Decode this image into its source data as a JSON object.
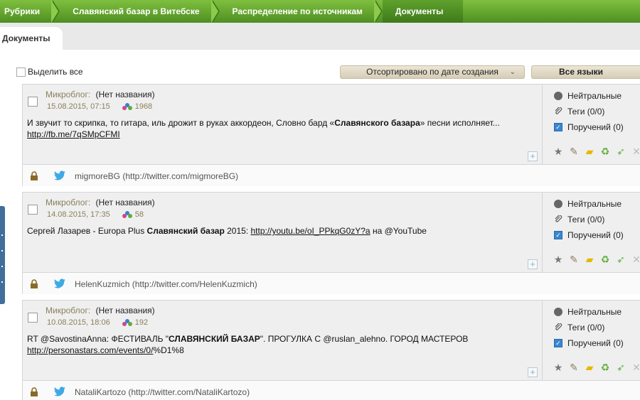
{
  "breadcrumb": [
    "Рубрики",
    "Славянский базар в Витебске",
    "Распределение по источникам",
    "Документы"
  ],
  "tab": "Документы",
  "select_all": "Выделить все",
  "sort_label": "Отсортировано по дате создания",
  "lang_label": "Все языки",
  "cards": [
    {
      "source": "Микроблог:",
      "title": "(Нет названия)",
      "date": "15.08.2015, 07:15",
      "count": "1968",
      "text_pre": "И звучит то скрипка, то гитара, иль дрожит в руках аккордеон, Словно бард «",
      "text_bold": "Славянского базара",
      "text_post": "» песни исполняет...",
      "link": "http://fb.me/7qSMpCFMI",
      "link_suffix": "",
      "sentiment": "Нейтральные",
      "tags": "Теги (0/0)",
      "orders": "Поручений (0)",
      "author": "migmoreBG (http://twitter.com/migmoreBG)"
    },
    {
      "source": "Микроблог:",
      "title": "(Нет названия)",
      "date": "14.08.2015, 17:35",
      "count": "58",
      "text_pre": "Сергей Лазарев - Europa Plus ",
      "text_bold": "Славянский базар",
      "text_post": " 2015: ",
      "link": "http://youtu.be/oI_PPkqG0zY?a",
      "link_suffix": " на @YouTube",
      "sentiment": "Нейтральные",
      "tags": "Теги (0/0)",
      "orders": "Поручений (0)",
      "author": "HelenKuzmich (http://twitter.com/HelenKuzmich)"
    },
    {
      "source": "Микроблог:",
      "title": "(Нет названия)",
      "date": "10.08.2015, 18:06",
      "count": "192",
      "text_pre": "RT @SavostinaAnna: ФЕСТИВАЛЬ \"",
      "text_bold": "СЛАВЯНСКИЙ БАЗАР",
      "text_post": "\". ПРОГУЛКА С @ruslan_alehno. ГОРОД МАСТЕРОВ",
      "link": "http://personastars.com/events/0/",
      "link_suffix": "%D1%8",
      "sentiment": "Нейтральные",
      "tags": "Теги (0/0)",
      "orders": "Поручений (0)",
      "author": "NataliKartozo (http://twitter.com/NataliKartozo)"
    }
  ]
}
